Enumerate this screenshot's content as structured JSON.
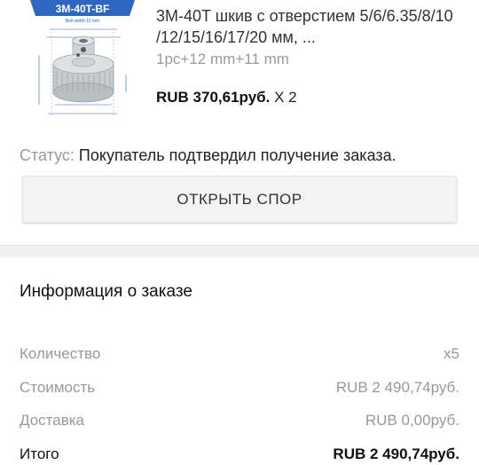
{
  "product": {
    "image_label": "3M-40T-BF",
    "image_sublabel": "Belt width:10 mm",
    "title": "3M-40T шкив с отверстием 5/6/6.35/8/10 /12/15/16/17/20 мм, ...",
    "variant": "1pc+12 mm+11 mm",
    "price": "RUB 370,61руб.",
    "quantity": "X 2"
  },
  "status": {
    "label": "Статус:",
    "value": "Покупатель подтвердил получение заказа."
  },
  "dispute_button": "ОТКРЫТЬ СПОР",
  "order_info": {
    "title": "Информация о заказе",
    "rows": [
      {
        "key": "Количество",
        "value": "x5"
      },
      {
        "key": "Стоимость",
        "value": "RUB 2 490,74руб."
      },
      {
        "key": "Доставка",
        "value": "RUB 0,00руб."
      },
      {
        "key": "Итого",
        "value": "RUB 2 490,74руб."
      }
    ]
  },
  "colors": {
    "badge_blue": "#2f66c4",
    "muted_text": "#999999",
    "button_bg": "#f3f3f3"
  }
}
